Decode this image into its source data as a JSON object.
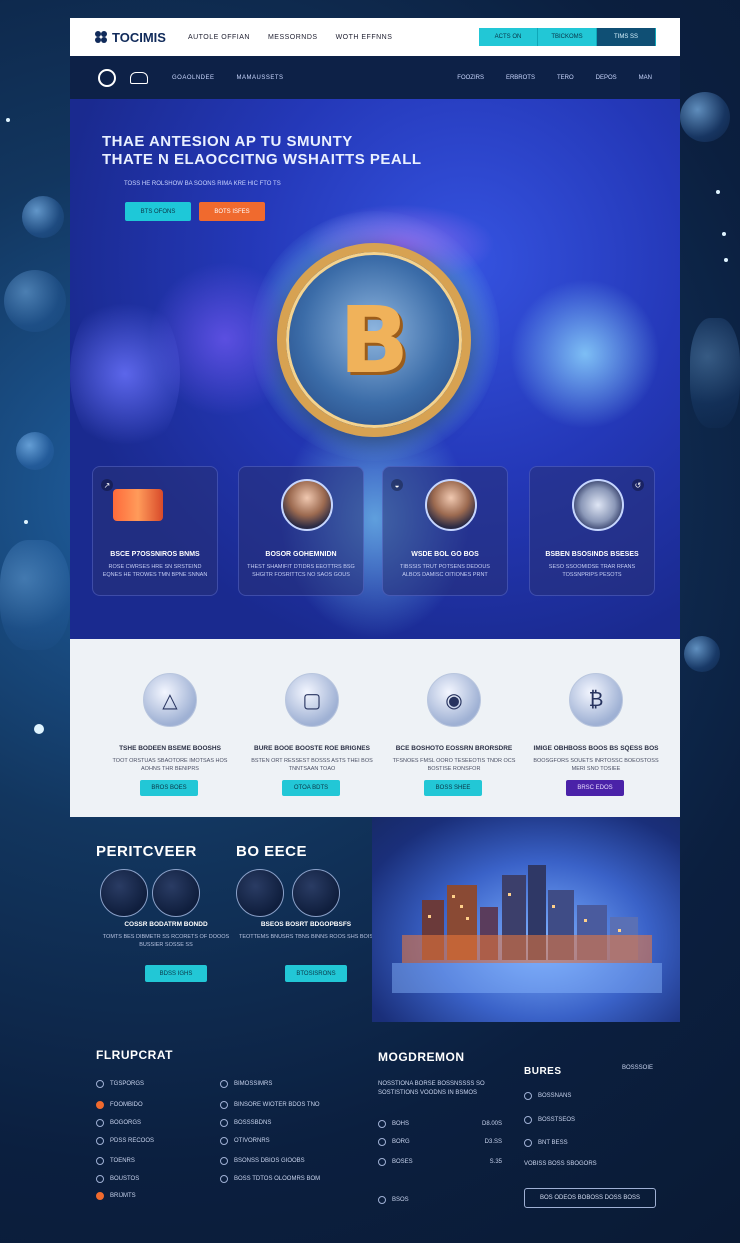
{
  "brand": {
    "name": "TOCIMIS"
  },
  "topbar": {
    "nav": [
      "AUTOLE OFFIAN",
      "MESSORNDS",
      "WOTH EFFNNS"
    ],
    "buttons": [
      "ACTS ON",
      "TBICKOMS",
      "TIMS SS"
    ]
  },
  "navbar": {
    "left": [
      "GOAOLNDEE",
      "MAMAUSSETS"
    ],
    "right": [
      "FOOZIRS",
      "ERBROTS",
      "TERO",
      "DEPOS",
      "MAN"
    ]
  },
  "hero": {
    "title_line1": "THAE ANTESION AP TU SMUNTY",
    "title_line2": "THATE N ELAOCCITNG WSHAITTS PEALL",
    "subtitle": "TOSS HE ROLSHOW BA SOONS RIMA KRE HIC FTO TS",
    "btn_primary": "BTS OFONS",
    "btn_secondary": "BOTS ISFES",
    "coin_symbol": "B",
    "cards": [
      {
        "title": "BSCE P7OSSNIROS BNMS",
        "text": "ROSE CWRSES HRE SN SRSTEIND EQNES HE TROWES TMN BPNE SNNAN",
        "mini": "↗"
      },
      {
        "title": "BOSOR GOHEMNIDN",
        "text": "THEST SHAMIFIT DTIDRS EEOTTRS BSG SHGITR FOSRITTCS NO SAOS GOUS",
        "mini": ""
      },
      {
        "title": "WSDE BOL GO BOS",
        "text": "TIBSSIS TRUT POTSENS DEDOUS ALBOS DAMISC OITIONES PRNT",
        "mini": "◒"
      },
      {
        "title": "BSBEN BSOSINDS BSESES",
        "text": "SESO SSOOMIDSE TRAR RFANS TOSSNPRIPS PESOTS",
        "mini": "↺"
      }
    ]
  },
  "features": [
    {
      "title": "TSHE BODEEN BSEME BOOSHS",
      "text": "TOOT ORSTUAS SBAOTORE IMOTSAS HOS AOHNS THR BENIPRS",
      "button": "BROS BOES",
      "variant": "teal"
    },
    {
      "title": "BURE BOOE BOOSTE ROE BRIGNES",
      "text": "BSTEN ORT RESSEST BOSSS ASTS THEI BOS TNNTSAAN TOAO",
      "button": "OTOA BDTS",
      "variant": "teal"
    },
    {
      "title": "BCE BOSHOTO EOSSRN BRORSDRE",
      "text": "TFSNOES FMSL OORO TESEEOTIS TNDR OCS BOSTISE RONSFOR",
      "button": "BOSS SHEE",
      "variant": "teal"
    },
    {
      "title": "IMIGE OBHBOSS BOOS BS SQESS BOS",
      "text": "BOOSGFORS SOUETS INRTOSSC BOEOSTOSS MERI SNO TOSIEE",
      "button": "BRSC EDOS",
      "variant": "purple"
    }
  ],
  "perks": [
    {
      "heading": "PERITCVEER",
      "title": "COSSR BODATRM BONDD",
      "text": "TOMTS BES DIBMETR SS RCORETS OF DOOOS BUSSIER SOSSE SS",
      "button": "BDSS IGHS"
    },
    {
      "heading": "BO EECE",
      "title": "BSEOS BOSRT BDGOPBSFS",
      "text": "TEOTTEMS BNUSRS TBNS BINNS ROOS SHS BOIS",
      "button": "BTOSISRONS"
    }
  ],
  "footer": {
    "col1_title": "FLRUPCRAT",
    "col1": [
      "TGSPORGS",
      "FOOMBIDO",
      "BOGORGS",
      "PDSS RECOOS",
      "TOENRS",
      "BOUSTOS",
      "BRIJMTS"
    ],
    "col2": [
      "BIMOSSIMRS",
      "BINSORE WIOTER BDOS TNO",
      "BOSSSBDNS",
      "OTIVORNRS",
      "BSONSS DBIOS GIOOBS",
      "BOSS TDTOS OLOOMRS BOM"
    ],
    "col3_title": "MOGDREMON",
    "col3_text": "NOSSTIONA BORSE BOSSNSSSS SO SOSTISTIONS VOODNS IN BSMOS",
    "col3_rows": [
      {
        "label": "BOHS",
        "value": "D8.00S"
      },
      {
        "label": "BORG",
        "value": "D3.SS"
      },
      {
        "label": "BOSES",
        "value": "S.35"
      },
      {
        "label": "BSOS",
        "value": ""
      }
    ],
    "col4_title": "BURES",
    "col4_badge": "BOSSSOIE",
    "col4": [
      "BOSSNANS",
      "BOSSTSEOS",
      "BNT BESS",
      "VOBISS BOSS SBOGORS"
    ],
    "subscribe": "BOS ODEOS BOBOSS DOSS BOSS"
  }
}
